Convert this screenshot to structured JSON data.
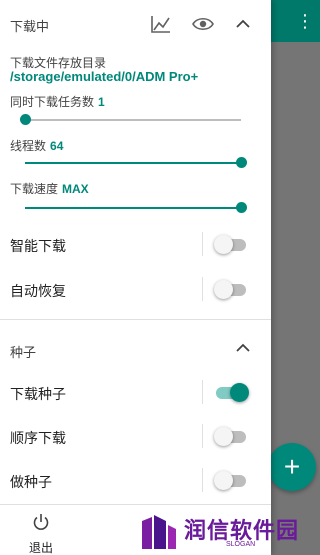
{
  "background": {
    "menu_glyph": "⋮",
    "fab_glyph": "+"
  },
  "downloading": {
    "title": "下载中",
    "icons": [
      "chart-icon",
      "eye-icon",
      "chevron-up-icon"
    ],
    "save_dir_label": "下载文件存放目录",
    "save_dir_value": "/storage/emulated/0/ADM Pro+",
    "concurrent_label": "同时下载任务数",
    "concurrent_value": "1",
    "concurrent_level": 0.0,
    "threads_label": "线程数",
    "threads_value": "64",
    "threads_level": 1.0,
    "speed_label": "下载速度",
    "speed_value": "MAX",
    "speed_level": 1.0,
    "smart_download_label": "智能下载",
    "smart_download_on": false,
    "auto_resume_label": "自动恢复",
    "auto_resume_on": false
  },
  "torrent": {
    "title": "种子",
    "download_torrent_label": "下载种子",
    "download_torrent_on": true,
    "sequential_label": "顺序下载",
    "sequential_on": false,
    "seeding_label": "做种子",
    "seeding_on": false
  },
  "bottom": {
    "exit_label": "退出"
  },
  "watermark": {
    "text": "润信软件园",
    "slogan": "SLOGAN",
    "color": "#6a1b9a"
  },
  "colors": {
    "accent": "#00897b",
    "toolbar": "#00796b"
  }
}
